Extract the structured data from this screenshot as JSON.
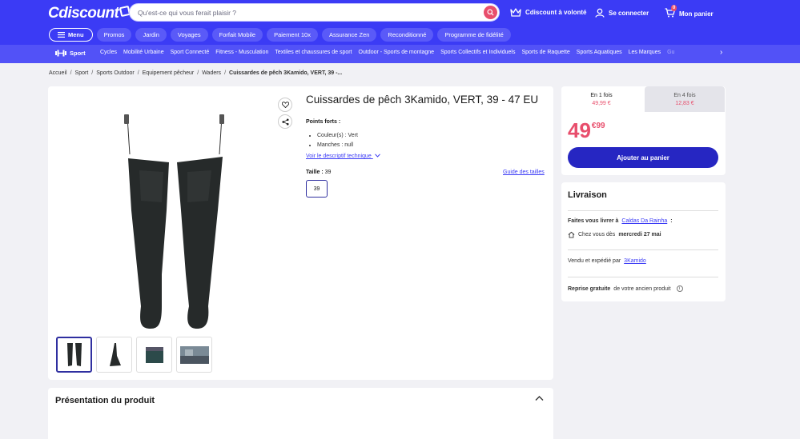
{
  "header": {
    "logo_text": "Cdiscount",
    "search_placeholder": "Qu'est-ce qui vous ferait plaisir ?",
    "actions": [
      {
        "label": "Cdiscount à volonté",
        "icon": "crown-icon"
      },
      {
        "label": "Se connecter",
        "icon": "user-icon"
      },
      {
        "label": "Mon panier",
        "icon": "cart-icon",
        "badge": "0"
      }
    ],
    "menu_label": "Menu",
    "pills": [
      "Promos",
      "Jardin",
      "Voyages",
      "Forfait Mobile",
      "Paiement 10x",
      "Assurance Zen",
      "Reconditionné",
      "Programme de fidélité"
    ]
  },
  "category_bar": {
    "current": "Sport",
    "items": [
      "Cycles",
      "Mobilité Urbaine",
      "Sport Connecté",
      "Fitness - Musculation",
      "Textiles et chaussures de sport",
      "Outdoor - Sports de montagne",
      "Sports Collectifs et Individuels",
      "Sports de Raquette",
      "Sports Aquatiques",
      "Les Marques",
      "Gu"
    ]
  },
  "breadcrumb": [
    "Accueil",
    "Sport",
    "Sports Outdoor",
    "Equipement pêcheur",
    "Waders",
    "Cuissardes de pêch 3Kamido, VERT, 39 -..."
  ],
  "product": {
    "title": "Cuissardes de pêch 3Kamido, VERT, 39 - 47 EU",
    "highlights_title": "Points forts :",
    "highlights": [
      "Couleur(s) : Vert",
      "Manches : null"
    ],
    "tech_link": "Voir le descriptif technique",
    "size_label": "Taille :",
    "size_value": "39",
    "size_guide": "Guide des tailles",
    "size_option": "39",
    "thumbnails": 4
  },
  "presentation": {
    "title": "Présentation du produit"
  },
  "pricing": {
    "tab1_label": "En 1 fois",
    "tab1_price": "49,99 €",
    "tab2_label": "En 4 fois",
    "tab2_price": "12,83 €",
    "price_int": "49",
    "price_dec": "€99",
    "cart_button": "Ajouter au panier",
    "accent_color": "#e84e6c",
    "brand_color": "#3b3bf5"
  },
  "delivery": {
    "title": "Livraison",
    "deliver_prefix": "Faites vous livrer à",
    "deliver_city": "Caldas Da Rainha",
    "deliver_suffix": ":",
    "home_prefix": "Chez vous dès",
    "home_date": "mercredi 27 mai",
    "seller_prefix": "Vendu et expédié par",
    "seller_name": "3Kamido",
    "return_bold": "Reprise gratuite",
    "return_rest": "de votre ancien produit"
  }
}
